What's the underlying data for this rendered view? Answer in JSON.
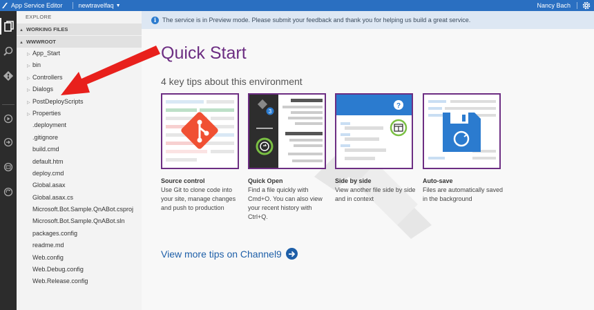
{
  "titlebar": {
    "app_title": "App Service Editor",
    "site": "newtravelfaq",
    "user": "Nancy Bach"
  },
  "explorer": {
    "header": "EXPLORE",
    "working_files": "WORKING FILES",
    "root": "WWWROOT",
    "folders": [
      "App_Start",
      "bin",
      "Controllers",
      "Dialogs",
      "PostDeployScripts",
      "Properties"
    ],
    "files": [
      ".deployment",
      ".gitignore",
      "build.cmd",
      "default.htm",
      "deploy.cmd",
      "Global.asax",
      "Global.asax.cs",
      "Microsoft.Bot.Sample.QnABot.csproj",
      "Microsoft.Bot.Sample.QnABot.sln",
      "packages.config",
      "readme.md",
      "Web.config",
      "Web.Debug.config",
      "Web.Release.config"
    ]
  },
  "banner": {
    "icon": "i",
    "text": "The service is in Preview mode. Please submit your feedback and thank you for helping us build a great service."
  },
  "quickstart": {
    "title": "Quick Start",
    "subtitle": "4 key tips about this environment",
    "tiles": [
      {
        "title": "Source control",
        "desc": "Use Git to clone code into your site, manage changes and push to production"
      },
      {
        "title": "Quick Open",
        "desc": "Find a file quickly with Cmd+O. You can also view your recent history with Ctrl+Q."
      },
      {
        "title": "Side by side",
        "desc": "View another file side by side and in context"
      },
      {
        "title": "Auto-save",
        "desc": "Files are automatically saved in the background"
      }
    ],
    "badge_count": "3",
    "help_glyph": "?",
    "more_link": "View more tips on Channel9"
  },
  "colors": {
    "accent": "#2a6fc1",
    "title_purple": "#6c2d82",
    "git_orange": "#f05033",
    "link_blue": "#1e5fa8",
    "arrow_red": "#e8201c"
  },
  "icons": [
    "files-icon",
    "search-icon",
    "git-icon",
    "run-icon",
    "deploy-icon",
    "console-icon",
    "sync-icon",
    "gear-icon",
    "info-icon",
    "arrow-right-icon"
  ]
}
